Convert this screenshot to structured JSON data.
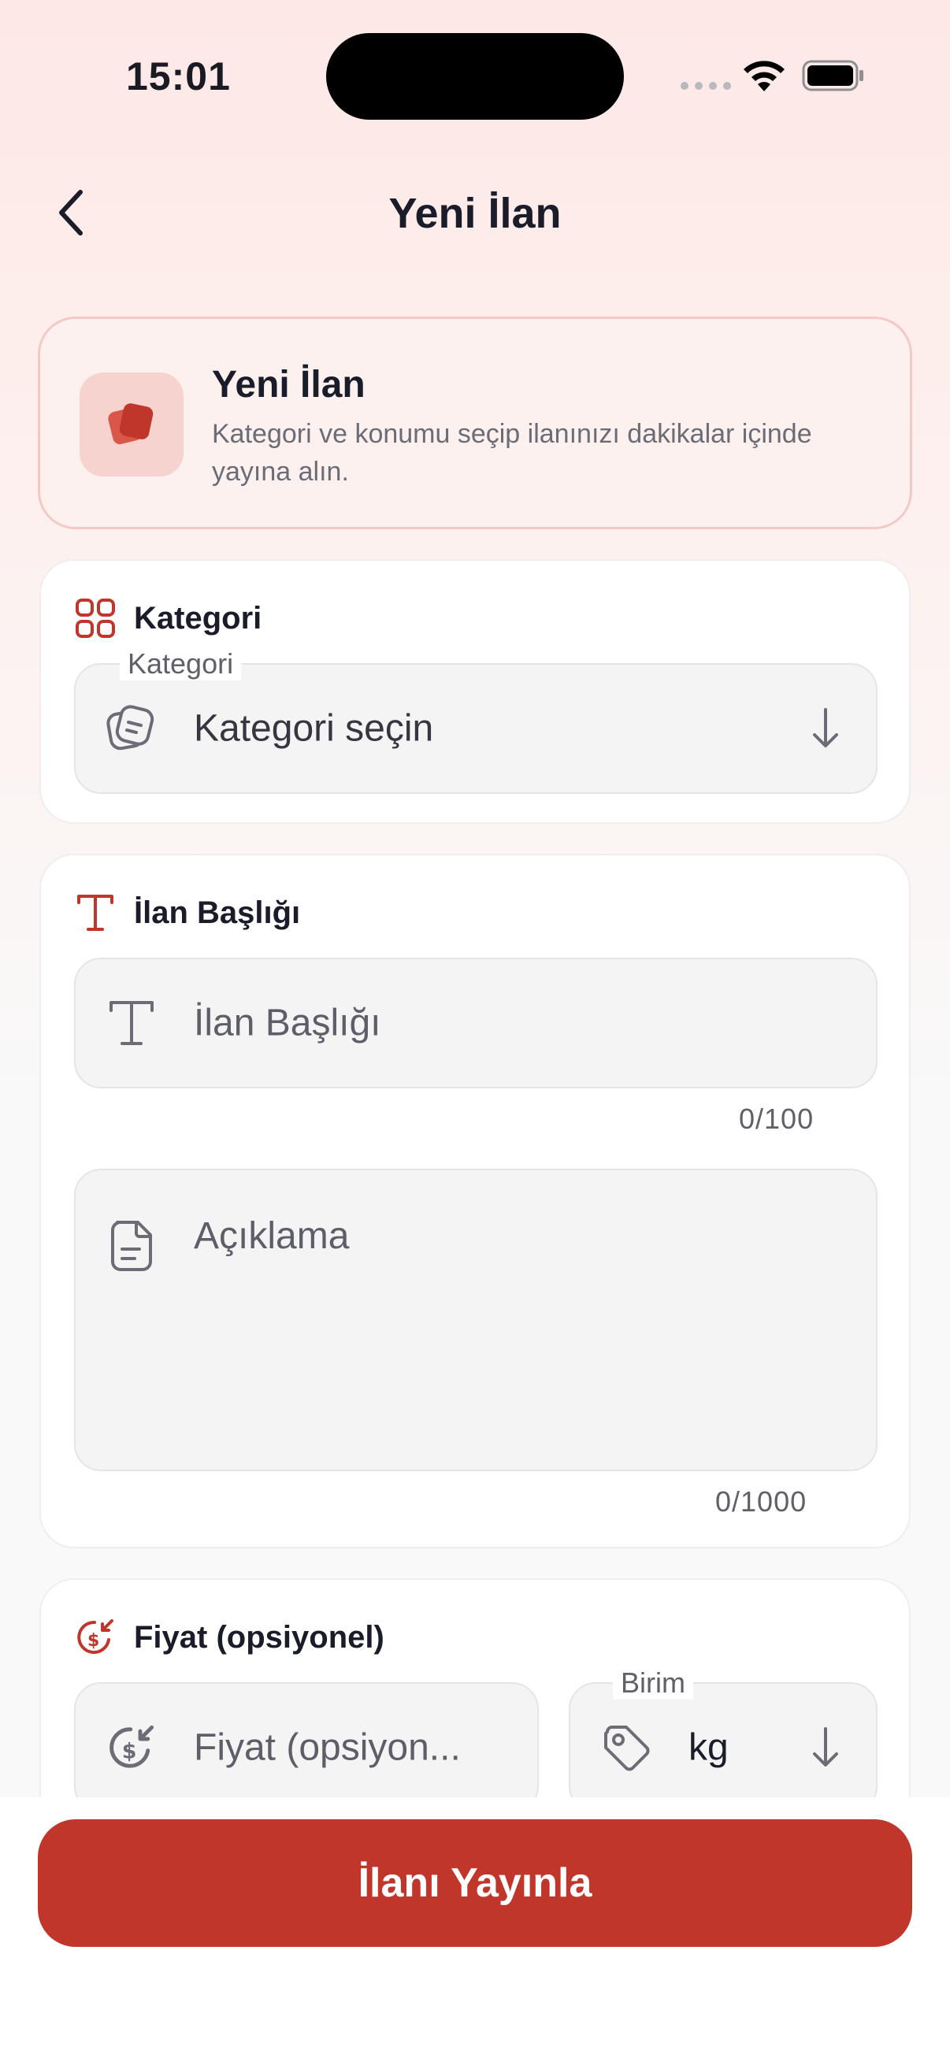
{
  "status_bar": {
    "time": "15:01"
  },
  "header": {
    "title": "Yeni İlan"
  },
  "intro": {
    "title": "Yeni İlan",
    "description": "Kategori ve konumu seçip ilanınızı dakikalar içinde yayına alın."
  },
  "category_section": {
    "heading": "Kategori",
    "field_label": "Kategori",
    "placeholder": "Kategori seçin"
  },
  "title_section": {
    "heading": "İlan Başlığı",
    "title_placeholder": "İlan Başlığı",
    "title_counter": "0/100",
    "description_placeholder": "Açıklama",
    "description_counter": "0/1000"
  },
  "price_section": {
    "heading": "Fiyat (opsiyonel)",
    "price_placeholder": "Fiyat (opsiyon...",
    "unit_label": "Birim",
    "unit_value": "kg"
  },
  "publish_button": "İlanı Yayınla",
  "colors": {
    "accent": "#c0362a",
    "accent_soft": "#f6d3cf",
    "field_bg": "#f4f4f4"
  }
}
